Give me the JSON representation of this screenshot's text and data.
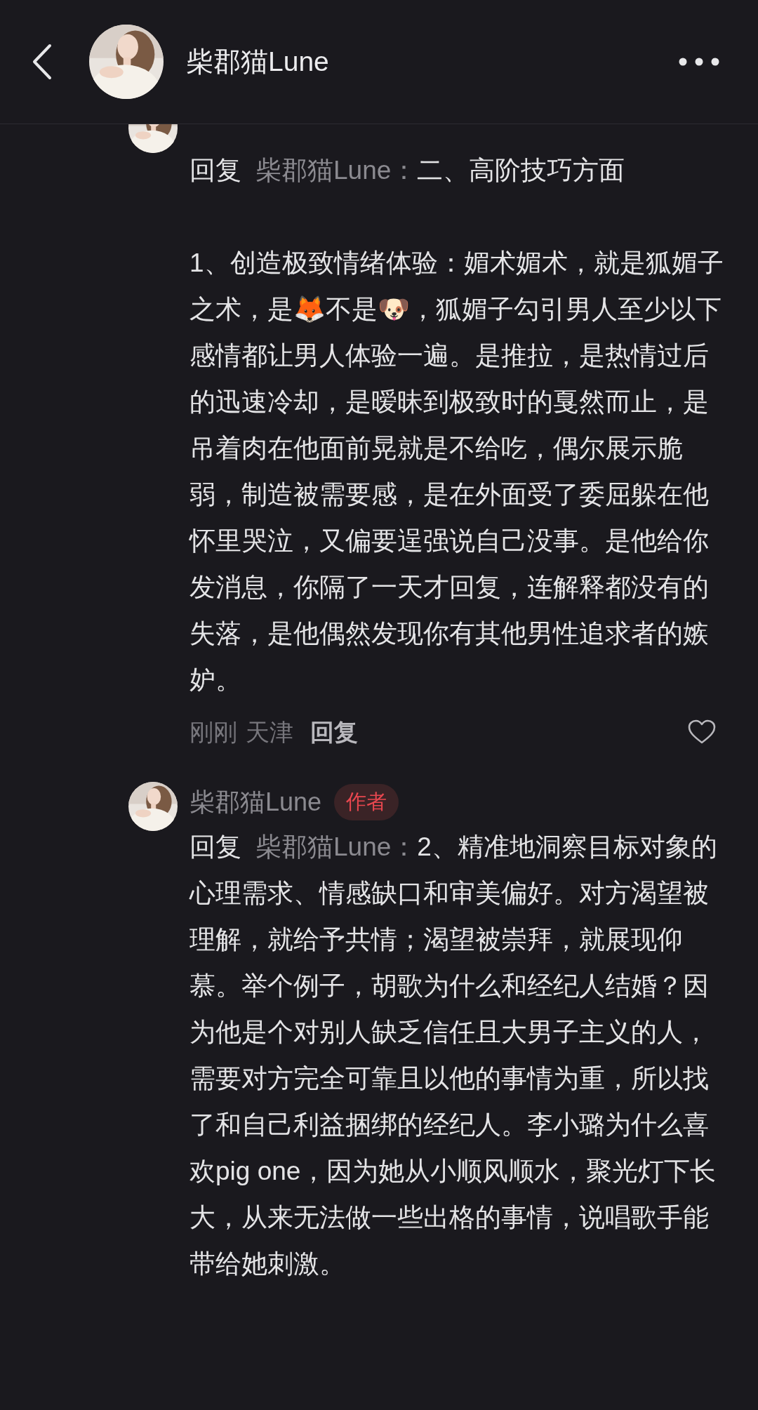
{
  "header": {
    "title": "柴郡猫Lune"
  },
  "comments": [
    {
      "reply_label": "回复",
      "reply_to": "柴郡猫Lune：",
      "text": "二、高阶技巧方面\n\n1、创造极致情绪体验：媚术媚术，就是狐媚子之术，是🦊不是🐶，狐媚子勾引男人至少以下感情都让男人体验一遍。是推拉，是热情过后的迅速冷却，是暧昧到极致时的戛然而止，是吊着肉在他面前晃就是不给吃，偶尔展示脆弱，制造被需要感，是在外面受了委屈躲在他怀里哭泣，又偏要逞强说自己没事。是他给你发消息，你隔了一天才回复，连解释都没有的失落，是他偶然发现你有其他男性追求者的嫉妒。",
      "meta": {
        "time": "刚刚",
        "location": "天津",
        "reply_button": "回复",
        "liked": false
      }
    },
    {
      "author": "柴郡猫Lune",
      "badge": "作者",
      "reply_label": "回复",
      "reply_to": "柴郡猫Lune：",
      "text": "2、精准地洞察目标对象的心理需求、情感缺口和审美偏好。对方渴望被理解，就给予共情；渴望被崇拜，就展现仰慕。举个例子，胡歌为什么和经纪人结婚？因为他是个对别人缺乏信任且大男子主义的人，需要对方完全可靠且以他的事情为重，所以找了和自己利益捆绑的经纪人。李小璐为什么喜欢pig one，因为她从小顺风顺水，聚光灯下长大，从来无法做一些出格的事情，说唱歌手能带给她刺激。"
    }
  ]
}
